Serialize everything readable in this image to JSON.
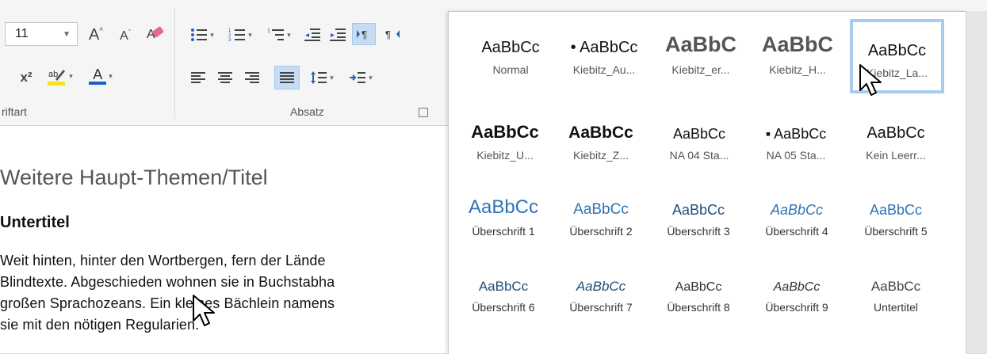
{
  "ribbon": {
    "font_group": {
      "font_size": "11",
      "grow_font": "A",
      "shrink_font": "A",
      "superscript": "x²",
      "font_color_letter": "A",
      "label": "riftart",
      "highlight_color": "#f3e21c",
      "font_color": "#1e5fc7"
    },
    "paragraph_group": {
      "label": "Absatz"
    }
  },
  "document": {
    "heading1": "Weitere Haupt-Themen/Titel",
    "heading2": "Untertitel",
    "body_lines": [
      "Weit hinten, hinter den Wortbergen, fern der Lände",
      "Blindtexte. Abgeschieden wohnen sie in Buchstabha",
      "großen Sprachozeans. Ein kleines Bächlein namens",
      "sie mit den nötigen Regularien."
    ]
  },
  "styles_gallery": {
    "selected": "Kiebitz_La...",
    "tiles": [
      {
        "preview": "AaBbCc",
        "label": "Normal"
      },
      {
        "preview": "• AaBbCc",
        "label": "Kiebitz_Au..."
      },
      {
        "preview": "AaBbC",
        "label": "Kiebitz_er..."
      },
      {
        "preview": "AaBbC",
        "label": "Kiebitz_H..."
      },
      {
        "preview": "AaBbCc",
        "label": "Kiebitz_La..."
      },
      {
        "preview": "AaBbCc",
        "label": "Kiebitz_U..."
      },
      {
        "preview": "AaBbCc",
        "label": "Kiebitz_Z..."
      },
      {
        "preview": "AaBbCc",
        "label": "NA 04 Sta..."
      },
      {
        "preview": "▪ AaBbCc",
        "label": "NA 05 Sta..."
      },
      {
        "preview": "AaBbCc",
        "label": "Kein Leerr..."
      },
      {
        "preview": "AaBbCc",
        "label": "Überschrift 1"
      },
      {
        "preview": "AaBbCc",
        "label": "Überschrift 2"
      },
      {
        "preview": "AaBbCc",
        "label": "Überschrift 3"
      },
      {
        "preview": "AaBbCc",
        "label": "Überschrift 4"
      },
      {
        "preview": "AaBbCc",
        "label": "Überschrift 5"
      },
      {
        "preview": "AaBbCc",
        "label": "Überschrift 6"
      },
      {
        "preview": "AaBbCc",
        "label": "Überschrift 7"
      },
      {
        "preview": "AaBbCc",
        "label": "Überschrift 8"
      },
      {
        "preview": "AaBbCc",
        "label": "Überschrift 9"
      },
      {
        "preview": "AaBbCc",
        "label": "Untertitel"
      }
    ]
  },
  "colors": {
    "heading_blue": "#2e74b5",
    "selection_border": "#a9cbef",
    "active_button": "#c5dcf3"
  }
}
